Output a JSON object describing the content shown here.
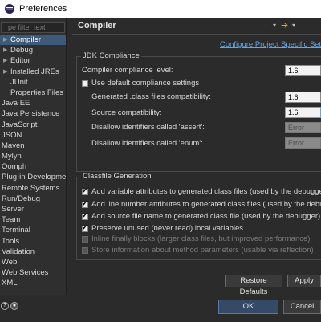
{
  "window": {
    "title": "Preferences"
  },
  "sidebar": {
    "filter_placeholder": "pe filter text",
    "items": [
      {
        "label": "Compiler",
        "level": 1,
        "expandable": true,
        "selected": true
      },
      {
        "label": "Debug",
        "level": 1,
        "expandable": true
      },
      {
        "label": "Editor",
        "level": 1,
        "expandable": true
      },
      {
        "label": "Installed JREs",
        "level": 1,
        "expandable": true
      },
      {
        "label": "JUnit",
        "level": 2
      },
      {
        "label": "Properties Files E",
        "level": 2
      },
      {
        "label": "Java EE",
        "level": 0
      },
      {
        "label": "Java Persistence",
        "level": 0
      },
      {
        "label": "JavaScript",
        "level": 0
      },
      {
        "label": "JSON",
        "level": 0
      },
      {
        "label": "Maven",
        "level": 0
      },
      {
        "label": "Mylyn",
        "level": 0
      },
      {
        "label": "Oomph",
        "level": 0
      },
      {
        "label": "Plug-in Developmer",
        "level": 0
      },
      {
        "label": "Remote Systems",
        "level": 0
      },
      {
        "label": "Run/Debug",
        "level": 0
      },
      {
        "label": "Server",
        "level": 0
      },
      {
        "label": "Team",
        "level": 0
      },
      {
        "label": "Terminal",
        "level": 0
      },
      {
        "label": "Tools",
        "level": 0
      },
      {
        "label": "Validation",
        "level": 0
      },
      {
        "label": "Web",
        "level": 0
      },
      {
        "label": "Web Services",
        "level": 0
      },
      {
        "label": "XML",
        "level": 0
      }
    ]
  },
  "page": {
    "title": "Compiler",
    "link": "Configure Project Specific Settin",
    "jdk": {
      "legend": "JDK Compliance",
      "compliance_label": "Compiler compliance level:",
      "compliance_value": "1.6",
      "use_default_label": "Use default compliance settings",
      "use_default_checked": false,
      "generated_label": "Generated .class files compatibility:",
      "generated_value": "1.6",
      "source_label": "Source compatibility:",
      "source_value": "1.6",
      "assert_label": "Disallow identifiers called 'assert':",
      "assert_value": "Error",
      "enum_label": "Disallow identifiers called 'enum':",
      "enum_value": "Error"
    },
    "classfile": {
      "legend": "Classfile Generation",
      "options": [
        {
          "label": "Add variable attributes to generated class files (used by the debugger)",
          "checked": true,
          "enabled": true
        },
        {
          "label": "Add line number attributes to generated class files (used by the debugge",
          "checked": true,
          "enabled": true
        },
        {
          "label": "Add source file name to generated class file (used by the debugger)",
          "checked": true,
          "enabled": true
        },
        {
          "label": "Preserve unused (never read) local variables",
          "checked": true,
          "enabled": true
        },
        {
          "label": "Inline finally blocks (larger class files, but improved performance)",
          "checked": false,
          "enabled": false
        },
        {
          "label": "Store information about method parameters (usable via reflection)",
          "checked": false,
          "enabled": false
        }
      ]
    },
    "buttons": {
      "restore": "Restore Defaults",
      "apply": "Apply"
    }
  },
  "footer": {
    "ok": "OK",
    "cancel": "Cancel"
  },
  "colors": {
    "accent": "#5fa8e8",
    "selection": "#3d5a7a",
    "forward_arrow": "#e0a800"
  }
}
